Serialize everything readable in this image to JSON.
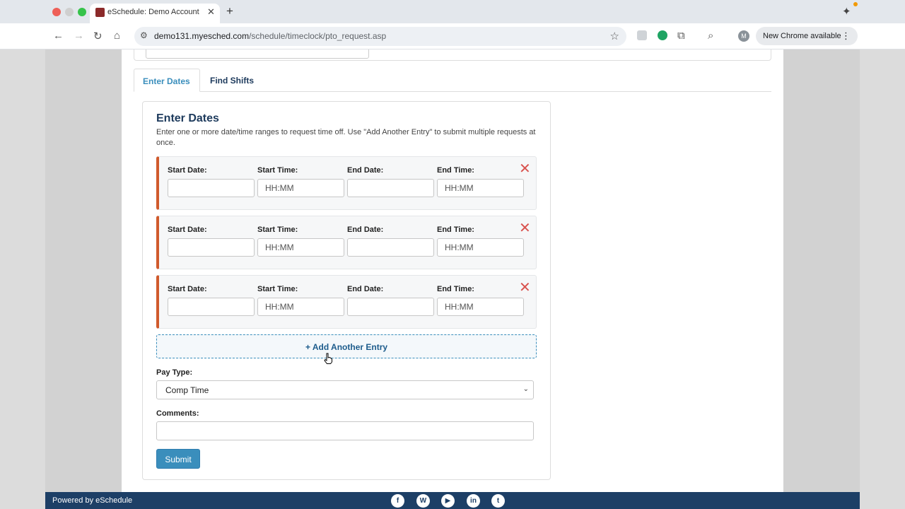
{
  "browser": {
    "tab_title": "eSchedule: Demo Account",
    "url_host": "demo131.myesched.com",
    "url_path": "/schedule/timeclock/pto_request.asp",
    "update_label": "New Chrome available",
    "avatar_letter": "M"
  },
  "tabs": [
    {
      "label": "Enter Dates",
      "active": true
    },
    {
      "label": "Find Shifts",
      "active": false
    }
  ],
  "panel": {
    "title": "Enter Dates",
    "description": "Enter one or more date/time ranges to request time off. Use \"Add Another Entry\" to submit multiple requests at once."
  },
  "entry_fields": {
    "start_date_label": "Start Date:",
    "start_time_label": "Start Time:",
    "end_date_label": "End Date:",
    "end_time_label": "End Time:",
    "time_placeholder": "HH:MM"
  },
  "entries": [
    {
      "start_date": "",
      "start_time": "",
      "end_date": "",
      "end_time": ""
    },
    {
      "start_date": "",
      "start_time": "",
      "end_date": "",
      "end_time": ""
    },
    {
      "start_date": "",
      "start_time": "",
      "end_date": "",
      "end_time": ""
    }
  ],
  "add_entry_label": "+ Add Another Entry",
  "pay_type": {
    "label": "Pay Type:",
    "selected": "Comp Time"
  },
  "comments": {
    "label": "Comments:",
    "value": ""
  },
  "submit_label": "Submit",
  "footer": {
    "powered_by": "Powered by eSchedule",
    "social_icons": [
      "facebook-icon",
      "wordpress-icon",
      "youtube-icon",
      "linkedin-icon",
      "twitter-icon"
    ]
  },
  "colors": {
    "brand_navy": "#1d3f66",
    "accent_blue": "#3a8ebc",
    "entry_accent": "#d05a2c",
    "remove_red": "#d9534f"
  }
}
